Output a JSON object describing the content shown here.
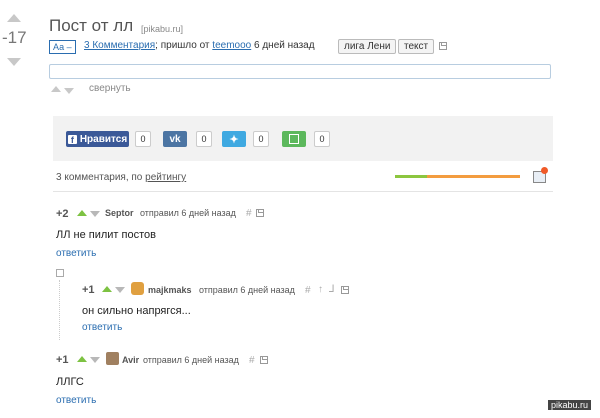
{
  "post": {
    "rating": "-17",
    "title": "Пост от лл",
    "source": "[pikabu.ru]",
    "font_toggle": "Аа –",
    "comments_link": "3 Комментария",
    "came_from": "; пришло от",
    "author": "teemooo",
    "time_ago": "6 дней назад",
    "tags": [
      "лига Лени",
      "текст"
    ],
    "collapse_label": "свернуть"
  },
  "share": {
    "buttons": [
      {
        "label": "Нравится",
        "count": "0",
        "color": "#3b5998"
      },
      {
        "label": "vk",
        "count": "0",
        "color": "#4c75a3"
      },
      {
        "label": "twitter",
        "count": "0",
        "color": "#3fa9e1"
      },
      {
        "label": "save",
        "count": "0",
        "color": "#5cb85c"
      }
    ]
  },
  "comments_header": {
    "text": "3 комментария, по",
    "sort_link": "рейтингу"
  },
  "comments": [
    {
      "rating": "+2",
      "author": "Septor",
      "meta": "отправил 6 дней назад",
      "hash": "#",
      "text": "ЛЛ не пилит постов",
      "reply": "ответить"
    },
    {
      "rating": "+1",
      "author": "majkmaks",
      "meta": "отправил 6 дней назад",
      "hash": "#",
      "text": "он сильно напрягся...",
      "reply": "ответить"
    },
    {
      "rating": "+1",
      "author": "Avir",
      "meta": "отправил 6 дней назад",
      "hash": "#",
      "text": "ЛЛГС",
      "reply": "ответить"
    }
  ],
  "watermark": "pikabu.ru",
  "colors": {
    "link": "#2a6db0",
    "upvote": "#7dc242",
    "bar_green": "#8cc63f",
    "bar_orange": "#f39c3f"
  }
}
